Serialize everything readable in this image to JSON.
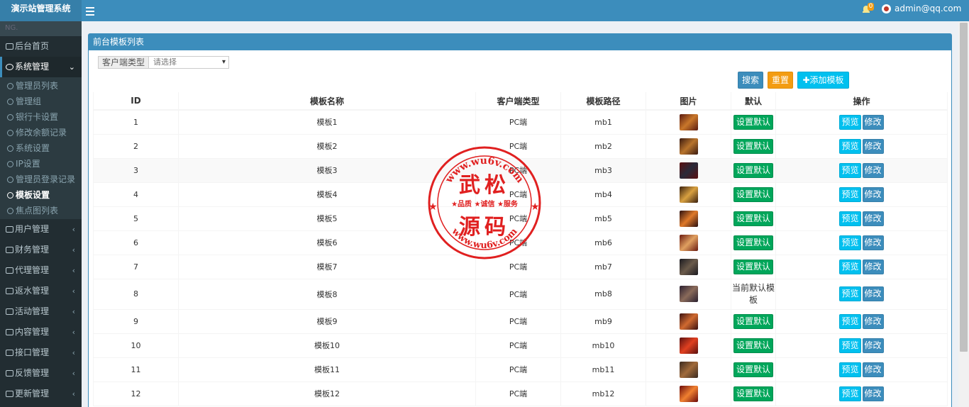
{
  "app": {
    "title": "演示站管理系统"
  },
  "header": {
    "notification_count": "0",
    "user": "admin@qq.com"
  },
  "sidebar": {
    "search_placeholder": "NG.",
    "home": "后台首页",
    "system": {
      "label": "系统管理",
      "items": [
        "管理员列表",
        "管理组",
        "银行卡设置",
        "修改余额记录",
        "系统设置",
        "IP设置",
        "管理员登录记录",
        "模板设置",
        "焦点图列表"
      ]
    },
    "menus": [
      "用户管理",
      "财务管理",
      "代理管理",
      "返水管理",
      "活动管理",
      "内容管理",
      "接口管理",
      "反馈管理",
      "更新管理"
    ]
  },
  "panel": {
    "title": "前台模板列表"
  },
  "filter": {
    "label": "客户端类型",
    "value": "请选择"
  },
  "buttons": {
    "search": "搜索",
    "reset": "重置",
    "add": "添加模板"
  },
  "table": {
    "headers": [
      "ID",
      "模板名称",
      "客户端类型",
      "模板路径",
      "图片",
      "默认",
      "操作"
    ],
    "default_label": "设置默认",
    "current_default_label": "当前默认模板",
    "preview_label": "预览",
    "edit_label": "修改",
    "rows": [
      {
        "id": "1",
        "name": "模板1",
        "client": "PC端",
        "path": "mb1",
        "is_default": false
      },
      {
        "id": "2",
        "name": "模板2",
        "client": "PC端",
        "path": "mb2",
        "is_default": false
      },
      {
        "id": "3",
        "name": "模板3",
        "client": "PC端",
        "path": "mb3",
        "is_default": false
      },
      {
        "id": "4",
        "name": "模板4",
        "client": "PC端",
        "path": "mb4",
        "is_default": false
      },
      {
        "id": "5",
        "name": "模板5",
        "client": "PC端",
        "path": "mb5",
        "is_default": false
      },
      {
        "id": "6",
        "name": "模板6",
        "client": "PC端",
        "path": "mb6",
        "is_default": false
      },
      {
        "id": "7",
        "name": "模板7",
        "client": "PC端",
        "path": "mb7",
        "is_default": false
      },
      {
        "id": "8",
        "name": "模板8",
        "client": "PC端",
        "path": "mb8",
        "is_default": true
      },
      {
        "id": "9",
        "name": "模板9",
        "client": "PC端",
        "path": "mb9",
        "is_default": false
      },
      {
        "id": "10",
        "name": "模板10",
        "client": "PC端",
        "path": "mb10",
        "is_default": false
      },
      {
        "id": "11",
        "name": "模板11",
        "client": "PC端",
        "path": "mb11",
        "is_default": false
      },
      {
        "id": "12",
        "name": "模板12",
        "client": "PC端",
        "path": "mb12",
        "is_default": false
      }
    ]
  },
  "watermark": {
    "url": "www.wu6v.com",
    "title_top": "武松",
    "slogan": "★品质 ★诚信 ★服务",
    "title_bottom": "源码"
  },
  "colors": {
    "topbar": "#3c8dbc",
    "sidebar": "#222d32",
    "success": "#00a65a",
    "info": "#00c0ef",
    "warning": "#f39c12",
    "stamp": "#e02020"
  }
}
